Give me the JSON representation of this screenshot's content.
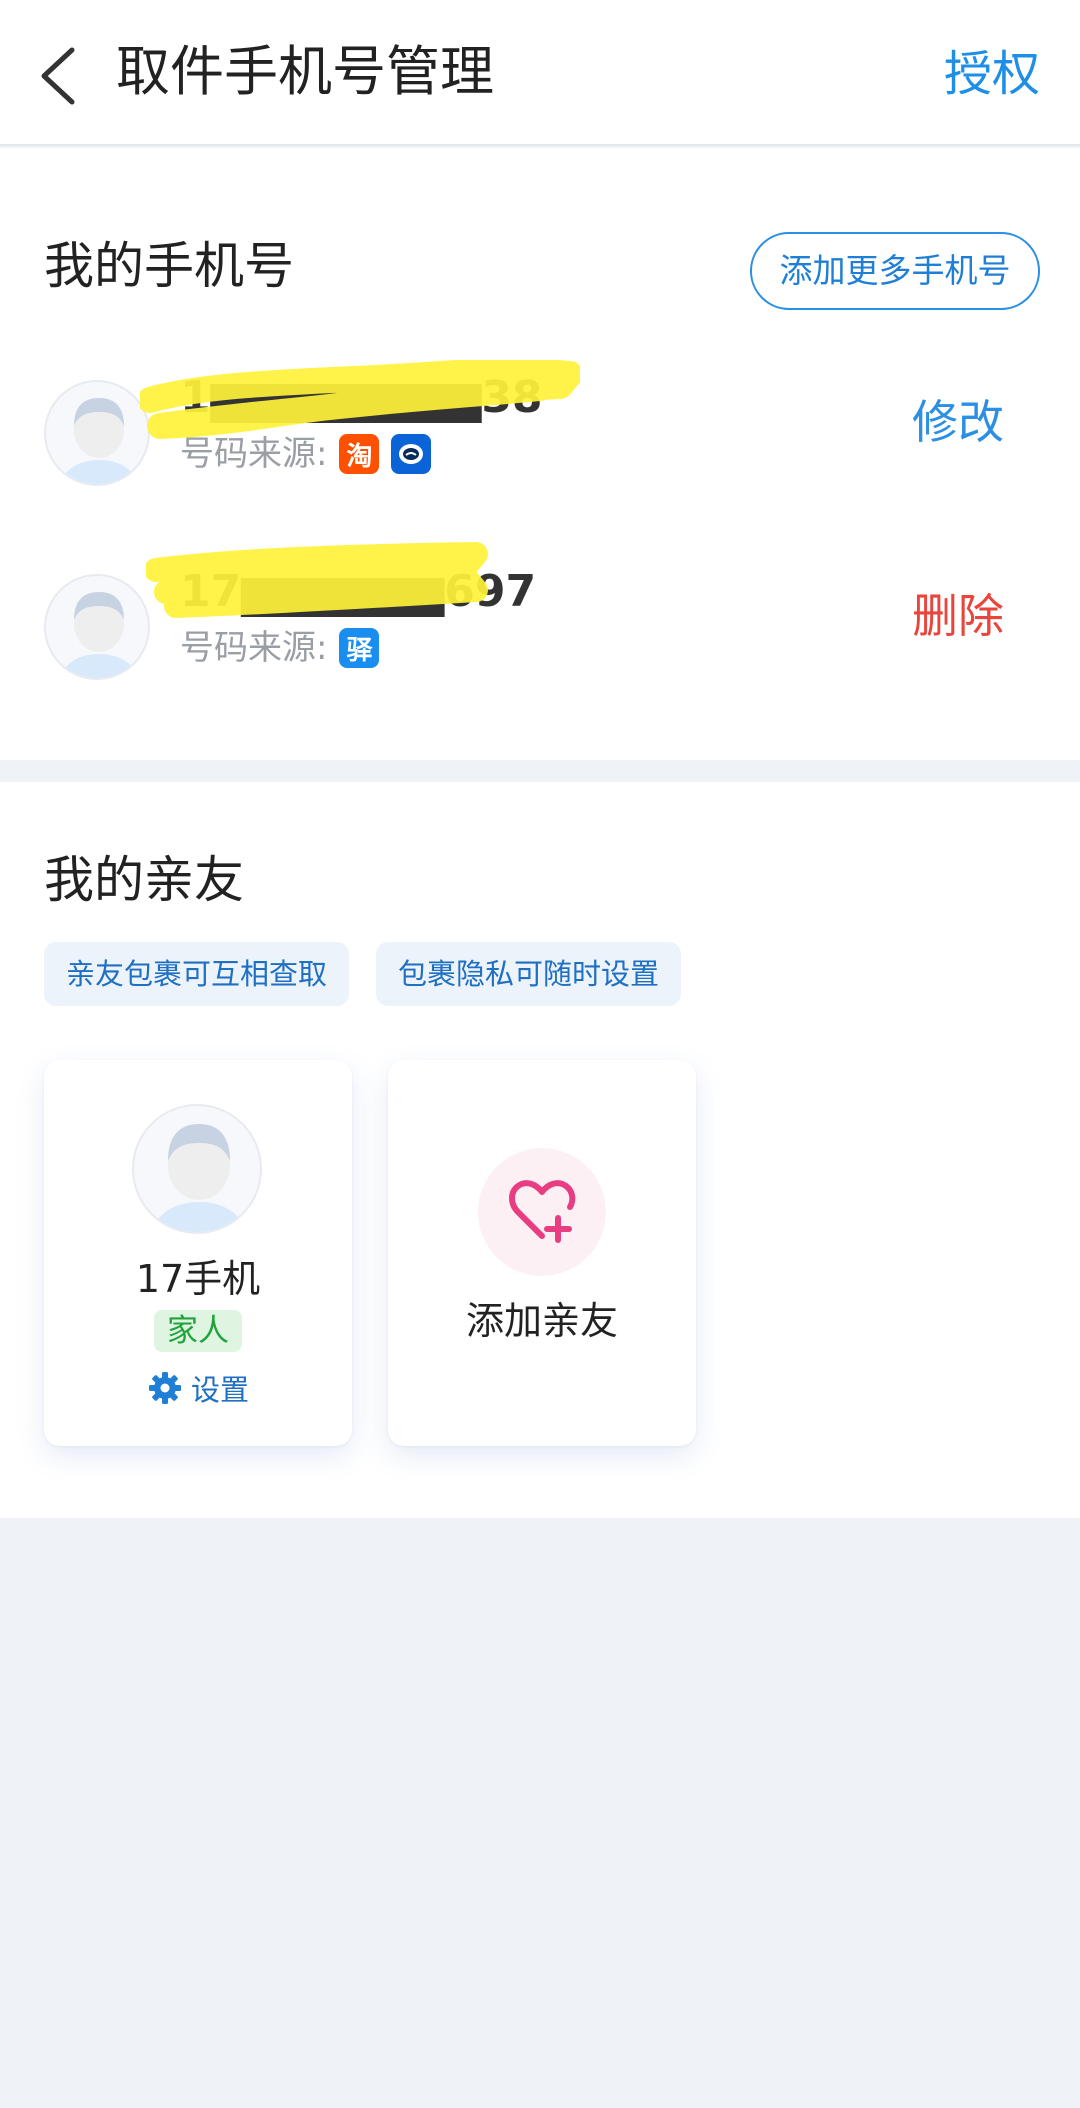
{
  "header": {
    "title": "取件手机号管理",
    "auth_label": "授权",
    "back_icon": "chevron-left-icon"
  },
  "phones": {
    "title": "我的手机号",
    "add_more_label": "添加更多手机号",
    "rows": [
      {
        "number": "1▆▆▆▆▆▆▆▆38",
        "source_label": "号码来源:",
        "sources": [
          {
            "icon": "taobao-icon",
            "glyph": "淘",
            "color": "#ff5000"
          },
          {
            "icon": "cainiao-icon",
            "glyph": "",
            "color": "#0a64d8"
          }
        ],
        "action_label": "修改",
        "action_color": "#2b8fe3"
      },
      {
        "number": "17▆▆▆▆▆▆697",
        "source_label": "号码来源:",
        "sources": [
          {
            "icon": "station-icon",
            "glyph": "驿",
            "color": "#1a8ef0"
          }
        ],
        "action_label": "删除",
        "action_color": "#e8453c"
      }
    ]
  },
  "friends": {
    "title": "我的亲友",
    "tags": [
      "亲友包裹可互相查取",
      "包裹隐私可随时设置"
    ],
    "members": [
      {
        "name": "17手机",
        "relation": "家人",
        "settings_label": "设置"
      }
    ],
    "add_label": "添加亲友"
  },
  "colors": {
    "accent": "#1f8ee6",
    "danger": "#e8453c",
    "highlight_redaction": "#fff23a",
    "relation_green": "#1fa33a",
    "heart_pink": "#e93d82"
  }
}
